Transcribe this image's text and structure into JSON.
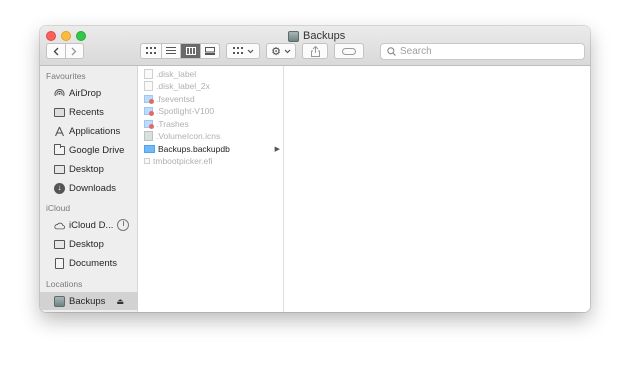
{
  "window": {
    "title": "Backups"
  },
  "search": {
    "placeholder": "Search"
  },
  "sidebar": {
    "sections": [
      {
        "heading": "Favourites",
        "items": [
          {
            "label": "AirDrop",
            "icon": "airdrop-icon"
          },
          {
            "label": "Recents",
            "icon": "recents-icon"
          },
          {
            "label": "Applications",
            "icon": "applications-icon"
          },
          {
            "label": "Google Drive",
            "icon": "folder-icon"
          },
          {
            "label": "Desktop",
            "icon": "desktop-icon"
          },
          {
            "label": "Downloads",
            "icon": "downloads-icon"
          }
        ]
      },
      {
        "heading": "iCloud",
        "items": [
          {
            "label": "iCloud D...",
            "icon": "cloud-icon"
          },
          {
            "label": "Desktop",
            "icon": "desktop-icon"
          },
          {
            "label": "Documents",
            "icon": "documents-icon"
          }
        ]
      },
      {
        "heading": "Locations",
        "items": [
          {
            "label": "Backups",
            "icon": "disk-icon",
            "selected": true
          }
        ]
      }
    ]
  },
  "files": [
    {
      "name": ".disk_label",
      "dim": true
    },
    {
      "name": ".disk_label_2x",
      "dim": true
    },
    {
      "name": ".fseventsd",
      "dim": true
    },
    {
      "name": ".Spotlight-V100",
      "dim": true
    },
    {
      "name": ".Trashes",
      "dim": true
    },
    {
      "name": ".VolumeIcon.icns",
      "dim": true
    },
    {
      "name": "Backups.backupdb",
      "dim": false
    },
    {
      "name": "tmbootpicker.efi",
      "dim": true
    }
  ],
  "colors": {
    "close": "#fc605b",
    "minimize": "#fdbc40",
    "maximize": "#34c84a",
    "folder": "#74b8f5"
  }
}
